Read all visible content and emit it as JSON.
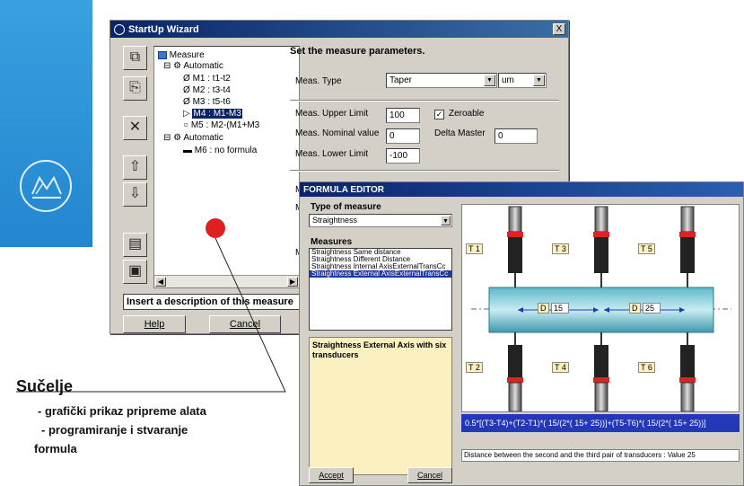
{
  "startup_wizard": {
    "title": "StartUp Wizard",
    "close_glyph": "X",
    "tree": {
      "root": "Measure",
      "group1": "Automatic",
      "items": [
        "M1 : t1-t2",
        "M2 : t3-t4",
        "M3 : t5-t6",
        "M4 : M1-M3",
        "M5 : M2-(M1+M3"
      ],
      "group2": "Automatic",
      "item6": "M6 : no formula"
    },
    "panel_title": "Set the measure parameters.",
    "meas_type_label": "Meas. Type",
    "meas_type_value": "Taper",
    "unit_value": "um",
    "upper_label": "Meas. Upper Limit",
    "upper_value": "100",
    "zeroable_label": "Zeroable",
    "nominal_label": "Meas. Nominal value",
    "nominal_value": "0",
    "delta_label": "Delta Master",
    "delta_value": "0",
    "lower_label": "Meas. Lower Limit",
    "lower_value": "-100",
    "hidden_m1": "M",
    "hidden_m2": "M",
    "hidden_m3": "M",
    "description_placeholder": "Insert a description of this measure",
    "help_label": "Help",
    "cancel_label": "Cancel"
  },
  "formula_editor": {
    "title": "FORMULA EDITOR",
    "type_label": "Type of measure",
    "type_value": "Straightness",
    "measures_label": "Measures",
    "measures": [
      "Straightness Same distance",
      "Straightness Different Distance",
      "Straightness Internal AxisExternalTransCc",
      "Straightness External AxisExternalTransCc"
    ],
    "description": "Straightness External Axis with six transducers",
    "transducers_top": [
      "T 1",
      "T 3",
      "T 5"
    ],
    "transducers_bottom": [
      "T 2",
      "T 4",
      "T 6"
    ],
    "distance1": {
      "label": "D",
      "value": "15"
    },
    "distance2": {
      "label": "D",
      "value": "25"
    },
    "formula": "0.5*[(T3-T4)+(T2-T1)*( 15/(2*( 15+ 25))]+(T5-T6)*( 15/(2*( 15+ 25))]",
    "status": "Distance between the second and the third pair of transducers : Value 25",
    "accept_label": "Accept",
    "cancel_label": "Cancel"
  },
  "caption": {
    "title": "Sučelje",
    "line1": "- grafički prikaz pripreme alata",
    "line2": "- programiranje i stvaranje",
    "line3": "formula"
  },
  "colors": {
    "accent_blue": "#2386cf",
    "title_bar": "#0a246a",
    "formula_bar": "#2238b8",
    "pointer_dot": "#e02020"
  }
}
